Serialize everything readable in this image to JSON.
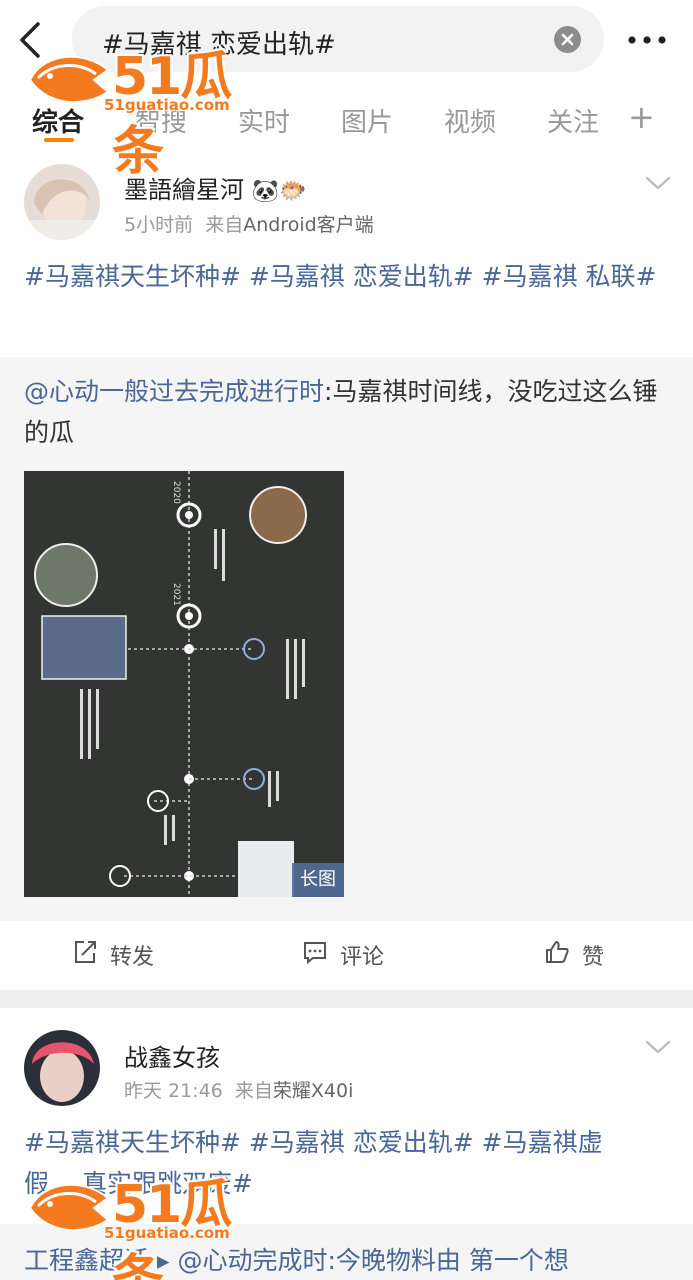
{
  "search": {
    "query": "#马嘉祺 恋爱出轨#"
  },
  "watermark": {
    "logo_text": "51瓜条",
    "url": "51guatiao.com"
  },
  "tabs": [
    {
      "label": "综合"
    },
    {
      "label": "智搜"
    },
    {
      "label": "实时"
    },
    {
      "label": "图片"
    },
    {
      "label": "视频"
    },
    {
      "label": "关注"
    }
  ],
  "posts": [
    {
      "username": "墨語繪星河",
      "badges": "🐼🐡",
      "time": "5小时前",
      "source_prefix": "来自",
      "source": "Android客户端",
      "tags": [
        "#马嘉祺天生坏种#",
        "#马嘉祺 恋爱出轨#",
        "#马嘉祺 私联#"
      ],
      "repost": {
        "mention": "@心动一般过去完成进行时",
        "text": ":马嘉祺时间线，没吃过这么锤的瓜"
      },
      "image_badge": "长图",
      "timeline_years": [
        "2020",
        "2021"
      ],
      "actions": {
        "forward": "转发",
        "comment": "评论",
        "like": "赞"
      }
    },
    {
      "username": "战鑫女孩",
      "time": "昨天 21:46",
      "source_prefix": "来自",
      "source": "荣耀X40i",
      "text_line1": "#马嘉祺天生坏种# #马嘉祺 恋爱出轨# #马嘉祺虚",
      "text_line2": "假… 真实跟跳双废#",
      "partial_line": "工程鑫超话 ▸ @心动完成时:今晚物料由 第一个想"
    }
  ],
  "colors": {
    "accent": "#ff8200",
    "link": "#4a6797",
    "watermark": "#f47a20"
  }
}
